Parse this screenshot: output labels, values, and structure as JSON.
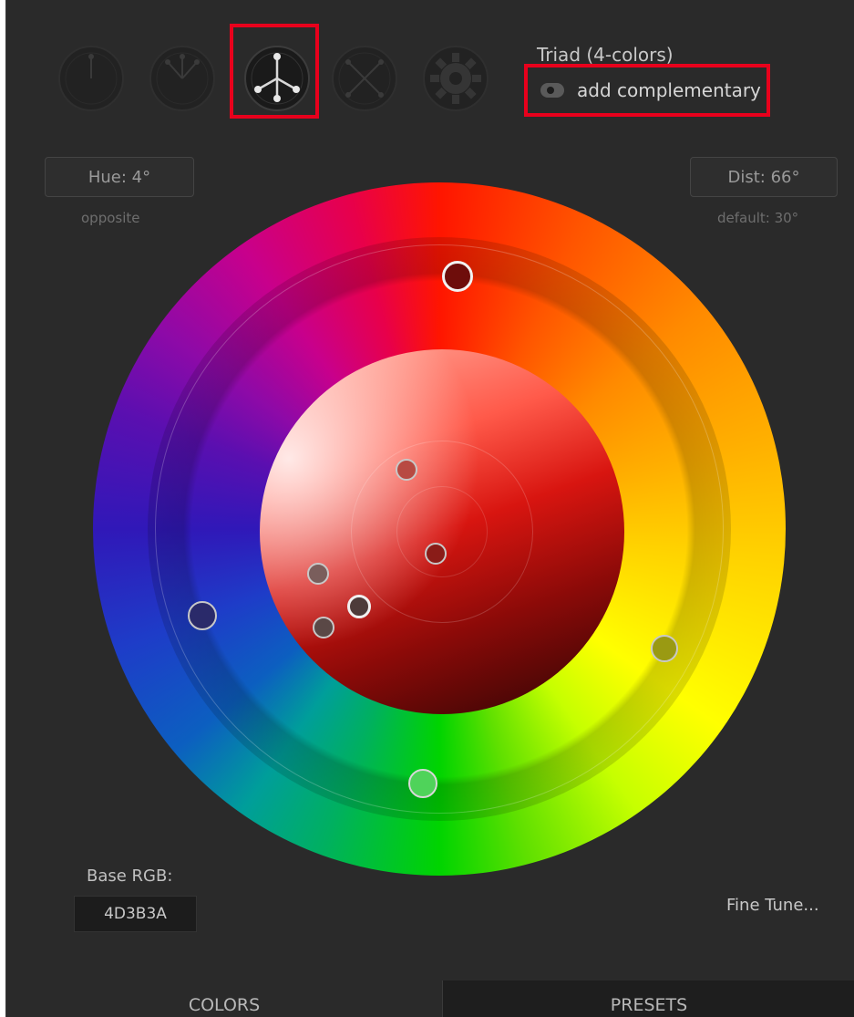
{
  "mode_selector": {
    "items": [
      {
        "name": "mono",
        "active": false
      },
      {
        "name": "analogic",
        "active": false
      },
      {
        "name": "triad",
        "active": true
      },
      {
        "name": "tetrad",
        "active": false
      },
      {
        "name": "custom",
        "active": false
      }
    ],
    "current_mode_label": "Triad (4-colors)",
    "add_complementary_label": "add complementary",
    "add_complementary_on": false
  },
  "hue": {
    "value_label": "Hue: 4°",
    "note": "opposite"
  },
  "distance": {
    "value_label": "Dist: 66°",
    "note": "default: 30°"
  },
  "base": {
    "label": "Base RGB:",
    "hex_value": "4D3B3A"
  },
  "fine_tune_label": "Fine Tune...",
  "tabs": [
    {
      "label": "COLORS",
      "active": true
    },
    {
      "label": "PRESETS",
      "active": false
    }
  ],
  "colors": {
    "highlight": "#e8001c",
    "panel": "#2a2a2a",
    "marker_primary": "#6e0d0b",
    "marker_secondary_left": "#2a2a6a",
    "marker_secondary_right": "#9a9a12",
    "marker_complement": "#4fd35a"
  }
}
